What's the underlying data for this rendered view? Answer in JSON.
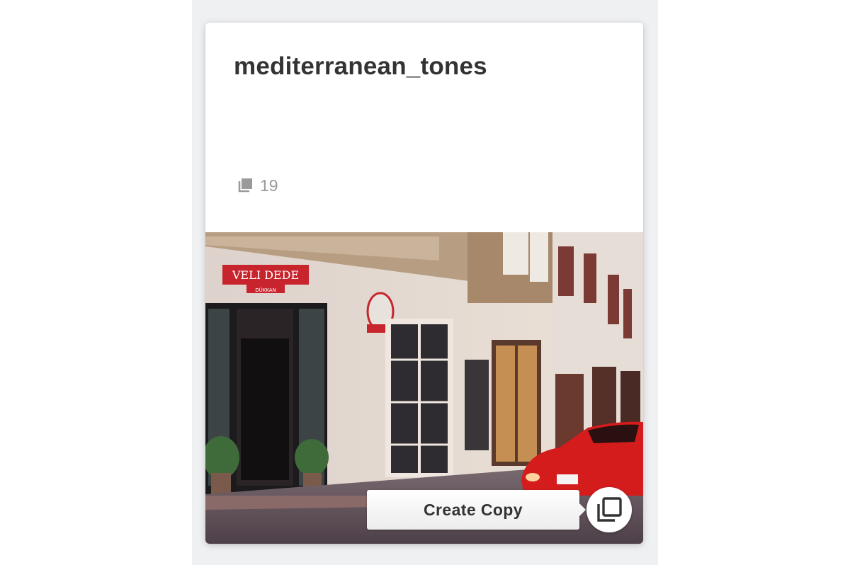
{
  "card": {
    "title": "mediterranean_tones",
    "image_count": "19",
    "count_icon": "stacked-photos-icon",
    "photo_shop_sign": "VELI DEDE",
    "photo_shop_sub_sign": "DÜKKAN"
  },
  "actions": {
    "create_copy_label": "Create Copy",
    "create_copy_icon": "copy-icon"
  },
  "colors": {
    "page_background": "#eff0f2",
    "card_background": "#ffffff",
    "title_text": "#333333",
    "muted_text": "#9a9a9a"
  }
}
